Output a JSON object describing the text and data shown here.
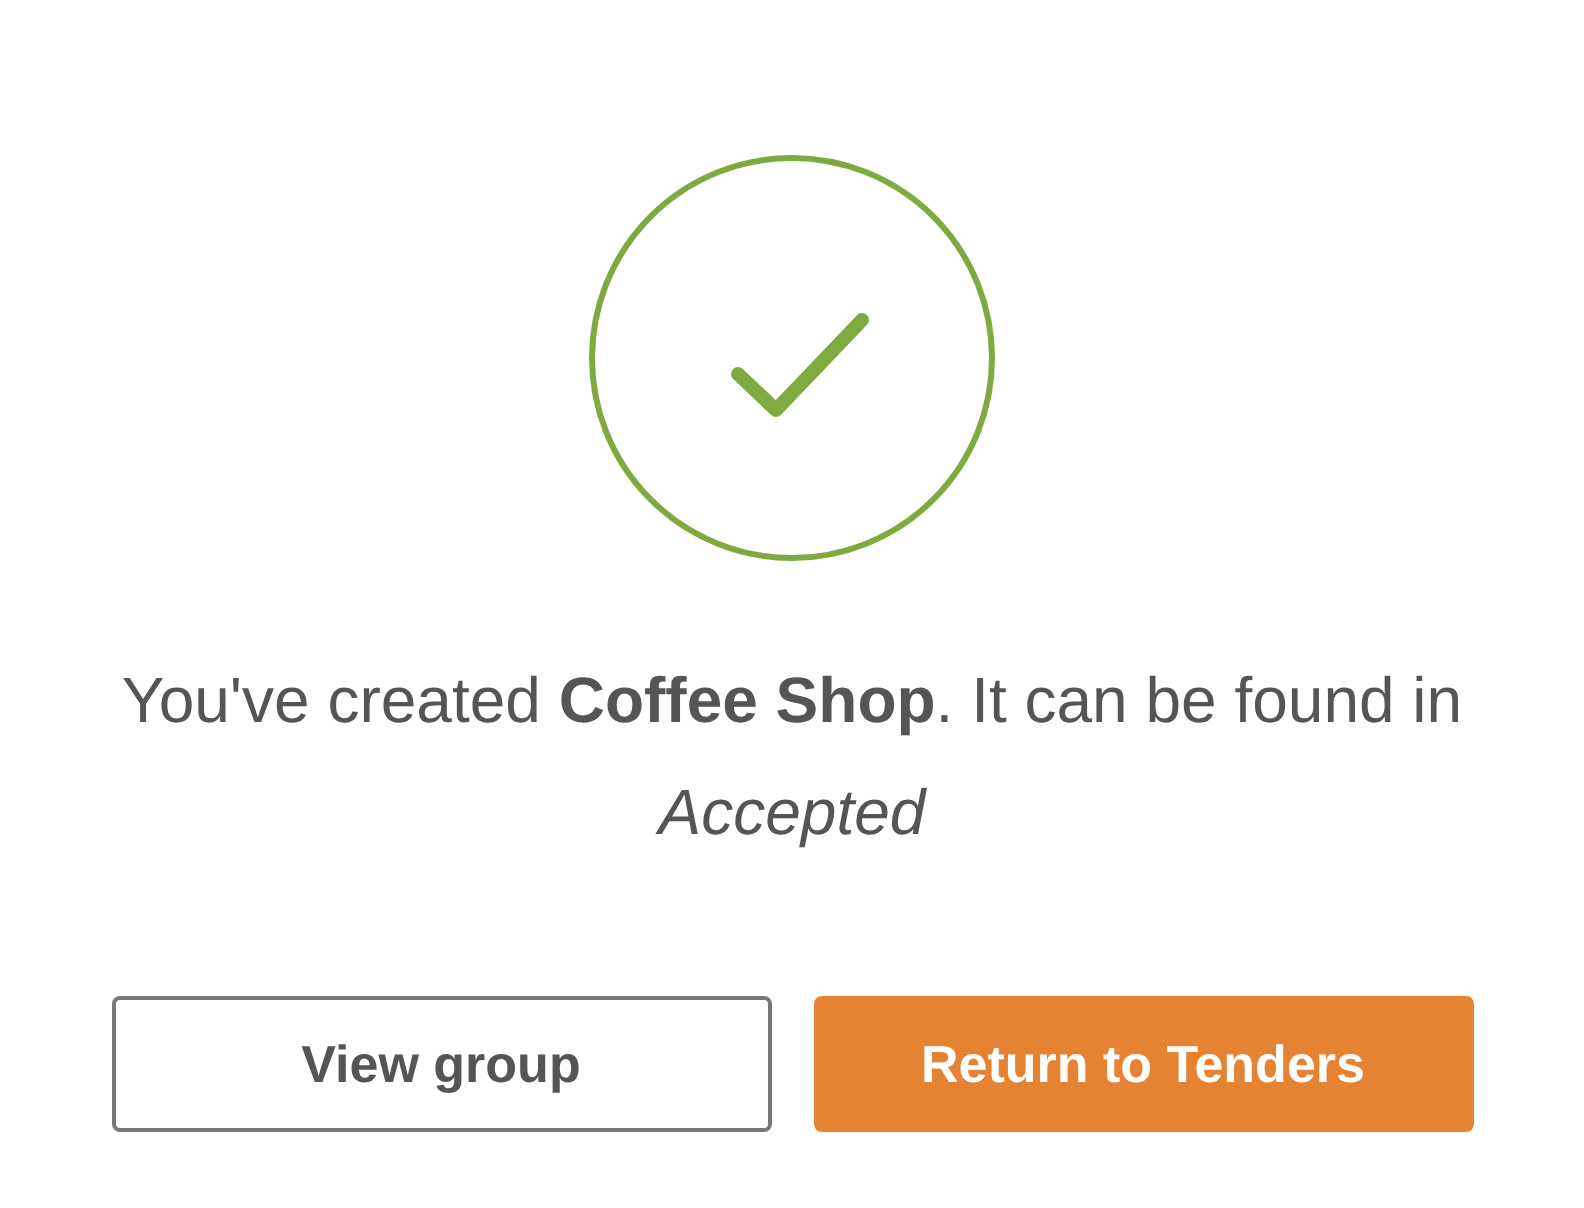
{
  "message": "You've created **Coffee Shop**. It can be found in *Accepted*",
  "buttons": [
    {
      "label": "View group",
      "kind": "secondary"
    },
    {
      "label": "Return to Tenders",
      "kind": "primary"
    }
  ]
}
